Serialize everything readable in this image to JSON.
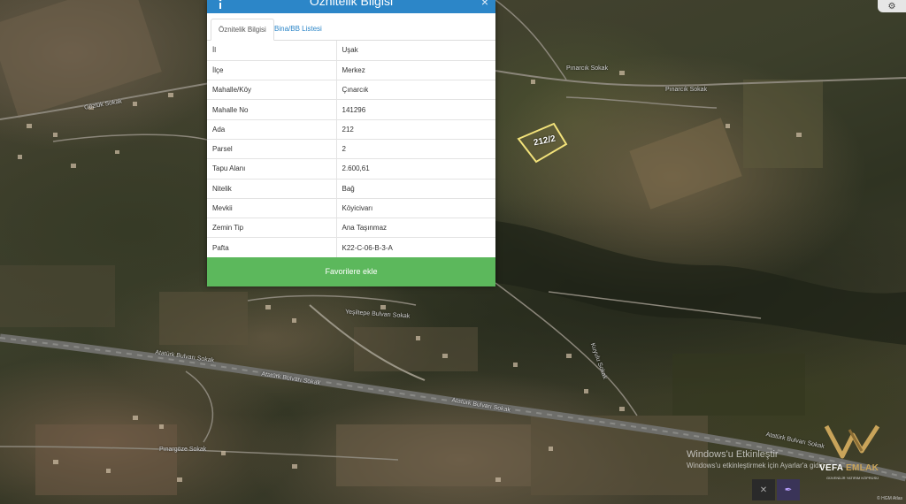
{
  "panel": {
    "title": "Öznitelik Bilgisi",
    "tabs": [
      {
        "label": "Öznitelik Bilgisi",
        "active": true
      },
      {
        "label": "Bina/BB Listesi",
        "active": false
      }
    ],
    "rows": [
      {
        "key": "İl",
        "value": "Uşak"
      },
      {
        "key": "İlçe",
        "value": "Merkez"
      },
      {
        "key": "Mahalle/Köy",
        "value": "Çınarcık"
      },
      {
        "key": "Mahalle No",
        "value": "141296"
      },
      {
        "key": "Ada",
        "value": "212"
      },
      {
        "key": "Parsel",
        "value": "2"
      },
      {
        "key": "Tapu Alanı",
        "value": "2.600,61"
      },
      {
        "key": "Nitelik",
        "value": "Bağ"
      },
      {
        "key": "Mevkii",
        "value": "Köyicivarı"
      },
      {
        "key": "Zemin Tip",
        "value": "Ana Taşınmaz"
      },
      {
        "key": "Pafta",
        "value": "K22-C-06-B-3-A"
      }
    ],
    "favorite_button": "Favorilere ekle",
    "colors": {
      "header": "#2c86c8",
      "button": "#5cb85c"
    }
  },
  "map": {
    "parcel_label": "212/2",
    "road_labels": [
      "Atatürk Bulvarı Sokak",
      "Atatürk Bulvarı Sokak",
      "Atatürk Bulvarı Sokak",
      "Atatürk Bulvarı Sokak",
      "Yeşiltepe Bulvarı Sokak",
      "Pınarcık Sokak",
      "Pınarcık Sokak",
      "Gözlük Sokak",
      "Pınargöze Sokak",
      "Kuyulu Sokak"
    ]
  },
  "watermark": {
    "line1": "Windows'u Etkinleştir",
    "line2": "Windows'u etkinleştirmek için Ayarlar'a gidin."
  },
  "logo": {
    "brand_a": "VEFA",
    "brand_b": "EMLAK",
    "slogan": "GÜVENİLİR YATIRIM KÖPRÜSÜ"
  },
  "copyright": "© HGM Atlas"
}
